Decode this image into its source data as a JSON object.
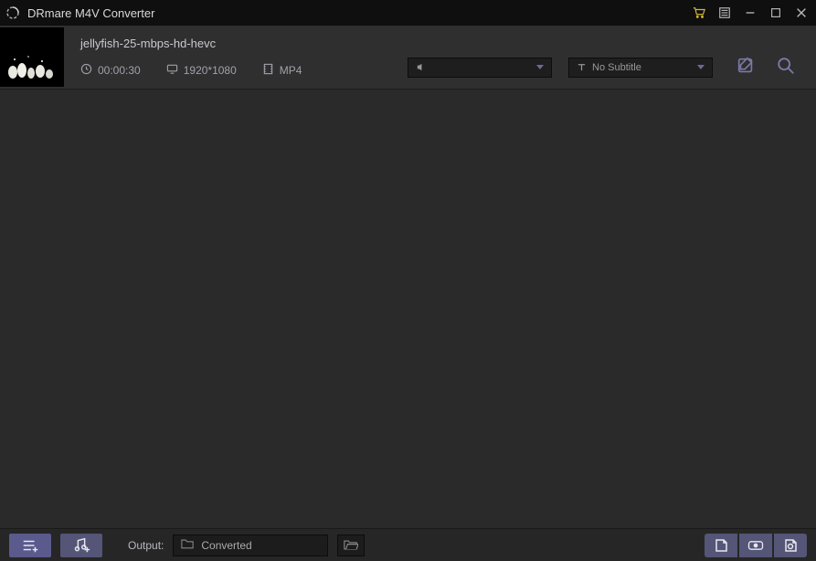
{
  "titlebar": {
    "title": "DRmare M4V Converter"
  },
  "file": {
    "title": "jellyfish-25-mbps-hd-hevc",
    "duration": "00:00:30",
    "resolution": "1920*1080",
    "format": "MP4",
    "audio_selected": "",
    "subtitle_selected": "No Subtitle"
  },
  "bottom": {
    "output_label": "Output:",
    "output_path": "Converted"
  },
  "icons": {
    "cart": "cart",
    "list": "list",
    "minimize": "minimize",
    "maximize": "maximize",
    "close": "close"
  }
}
